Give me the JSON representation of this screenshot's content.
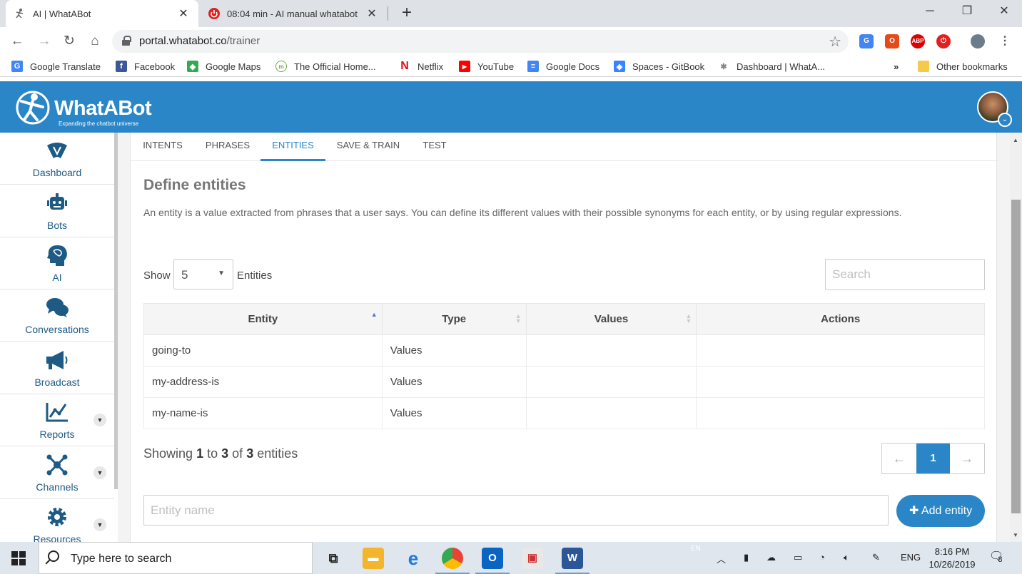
{
  "browser": {
    "tabs": [
      {
        "title": "AI | WhatABot",
        "active": true
      },
      {
        "title": "08:04 min - AI manual whatabot",
        "active": false
      }
    ],
    "url_host": "portal.whatabot.co",
    "url_path": "/trainer",
    "bookmarks": [
      {
        "label": "Google Translate",
        "icon": "google-translate-icon",
        "color": "#4285f4"
      },
      {
        "label": "Facebook",
        "icon": "facebook-icon",
        "color": "#3b5998"
      },
      {
        "label": "Google Maps",
        "icon": "google-maps-icon",
        "color": "#34a853"
      },
      {
        "label": "The Official Home...",
        "icon": "official-home-icon",
        "color": "#6aa84f"
      },
      {
        "label": "Netflix",
        "icon": "netflix-icon",
        "color": "#e50914"
      },
      {
        "label": "YouTube",
        "icon": "youtube-icon",
        "color": "#ff0000"
      },
      {
        "label": "Google Docs",
        "icon": "google-docs-icon",
        "color": "#4285f4"
      },
      {
        "label": "Spaces - GitBook",
        "icon": "gitbook-icon",
        "color": "#3884ff"
      },
      {
        "label": "Dashboard | WhatA...",
        "icon": "whatabot-icon",
        "color": "#888888"
      }
    ],
    "more_bookmarks": "»",
    "other_bookmarks": "Other bookmarks"
  },
  "app": {
    "brand": "WhatABot",
    "tagline": "Expanding the chatbot universe",
    "accent": "#2a86c7"
  },
  "sidebar": {
    "items": [
      {
        "label": "Dashboard",
        "icon": "dashboard-icon",
        "expandable": false
      },
      {
        "label": "Bots",
        "icon": "bot-icon",
        "expandable": false
      },
      {
        "label": "AI",
        "icon": "brain-head-icon",
        "expandable": false
      },
      {
        "label": "Conversations",
        "icon": "chat-bubbles-icon",
        "expandable": false
      },
      {
        "label": "Broadcast",
        "icon": "megaphone-icon",
        "expandable": false
      },
      {
        "label": "Reports",
        "icon": "line-chart-icon",
        "expandable": true
      },
      {
        "label": "Channels",
        "icon": "network-icon",
        "expandable": true
      },
      {
        "label": "Resources",
        "icon": "gear-icon",
        "expandable": true
      }
    ]
  },
  "trainer": {
    "tabs": [
      "INTENTS",
      "PHRASES",
      "ENTITIES",
      "SAVE & TRAIN",
      "TEST"
    ],
    "active_tab": "ENTITIES",
    "title": "Define entities",
    "description": "An entity is a value extracted from phrases that a user says. You can define its different values with their possible synonyms for each entity, or by using regular expressions.",
    "show_label": "Show",
    "page_size": "5",
    "entities_label": "Entities",
    "search_placeholder": "Search",
    "columns": [
      "Entity",
      "Type",
      "Values",
      "Actions"
    ],
    "rows": [
      {
        "entity": "going-to",
        "type": "Values",
        "values": "",
        "actions": ""
      },
      {
        "entity": "my-address-is",
        "type": "Values",
        "values": "",
        "actions": ""
      },
      {
        "entity": "my-name-is",
        "type": "Values",
        "values": "",
        "actions": ""
      }
    ],
    "showing": {
      "prefix": "Showing",
      "from": "1",
      "to_word": "to",
      "to": "3",
      "of_word": "of",
      "total": "3",
      "suffix": "entities"
    },
    "pager": {
      "prev": "←",
      "current": "1",
      "next": "→"
    },
    "entity_name_placeholder": "Entity name",
    "add_button": "Add entity"
  },
  "taskbar": {
    "search_text": "Type here to search",
    "lang_small": "EN",
    "language": "ENG",
    "time": "8:16 PM",
    "date": "10/26/2019",
    "notifications": "8"
  }
}
